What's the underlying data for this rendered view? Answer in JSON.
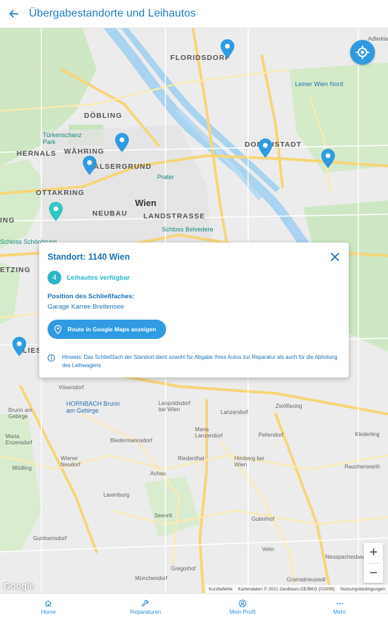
{
  "header": {
    "title": "Übergabestandorte und Leihautos"
  },
  "map": {
    "districts": [
      "FLORIDSDORF",
      "DÖBLING",
      "HERNALS",
      "WÄHRING",
      "ALSERGRUND",
      "DONAUSTADT",
      "OTTAKRING",
      "NEUBAU",
      "LANDSTRASSE",
      "ING",
      "ETZING",
      "LIES"
    ],
    "city": "Wien",
    "pois": {
      "tuerkenschanz": "Türkenschanz Park",
      "leiner": "Leiner Wien Nord",
      "prater": "Prater",
      "belvedere": "Schloss Belvedere",
      "schoenbrunn": "Schloss Schönbrunn",
      "hornbach": "HORNBACH Brunn am Gebirge"
    },
    "places": [
      "Vösendorf",
      "Brunn am Gebirge",
      "Maria Enzersdorf",
      "Mödling",
      "Wiener Neudorf",
      "Leopoldsdorf bei Wien",
      "Lanzendorf",
      "Zwölfaxing",
      "Maria Lanzendorf",
      "Biedermannsdorf",
      "Riedenthal",
      "Achau",
      "Laxenburg",
      "Himberg bei Wien",
      "Pellendorf",
      "Rauchenwarth",
      "Gutenhof",
      "Seeortl",
      "Velm",
      "Münchendorf",
      "Gregorhof",
      "Guntramsdorf",
      "Neuspachesbau",
      "Gramatneusiedl",
      "Klederling",
      "Adlerklaa"
    ],
    "google_logo": "Google",
    "attribution": {
      "shortcuts": "Kurzbefehle",
      "data": "Kartendaten © 2021 GeoBasis-DE/BKG (©2009)",
      "terms": "Nutzungsbedingungen"
    },
    "zoom_in": "+",
    "zoom_out": "−"
  },
  "card": {
    "title": "Standort: 1140 Wien",
    "available_count": "4",
    "available_label": "Leihautos verfügbar",
    "position_heading": "Position des Schließfaches:",
    "position_value": "Garage Karree Breitensee",
    "route_button": "Route in Google Maps anzeigen",
    "hint": "Hinweis: Das Schließfach der Standort dient sowohl für Abgabe Ihres Autos zur Reparatur als auch für die Abholung des Leihwagens"
  },
  "nav": [
    {
      "label": "Home",
      "icon": "home-icon"
    },
    {
      "label": "Reparaturen",
      "icon": "wrench-icon"
    },
    {
      "label": "Mein Profil",
      "icon": "profile-icon"
    },
    {
      "label": "Mehr",
      "icon": "more-icon"
    }
  ],
  "colors": {
    "primary": "#1d7fc4",
    "accent": "#2f9be0",
    "teal": "#28b5c8",
    "pin": "#2f9be0",
    "pin_teal": "#33c6c6"
  }
}
